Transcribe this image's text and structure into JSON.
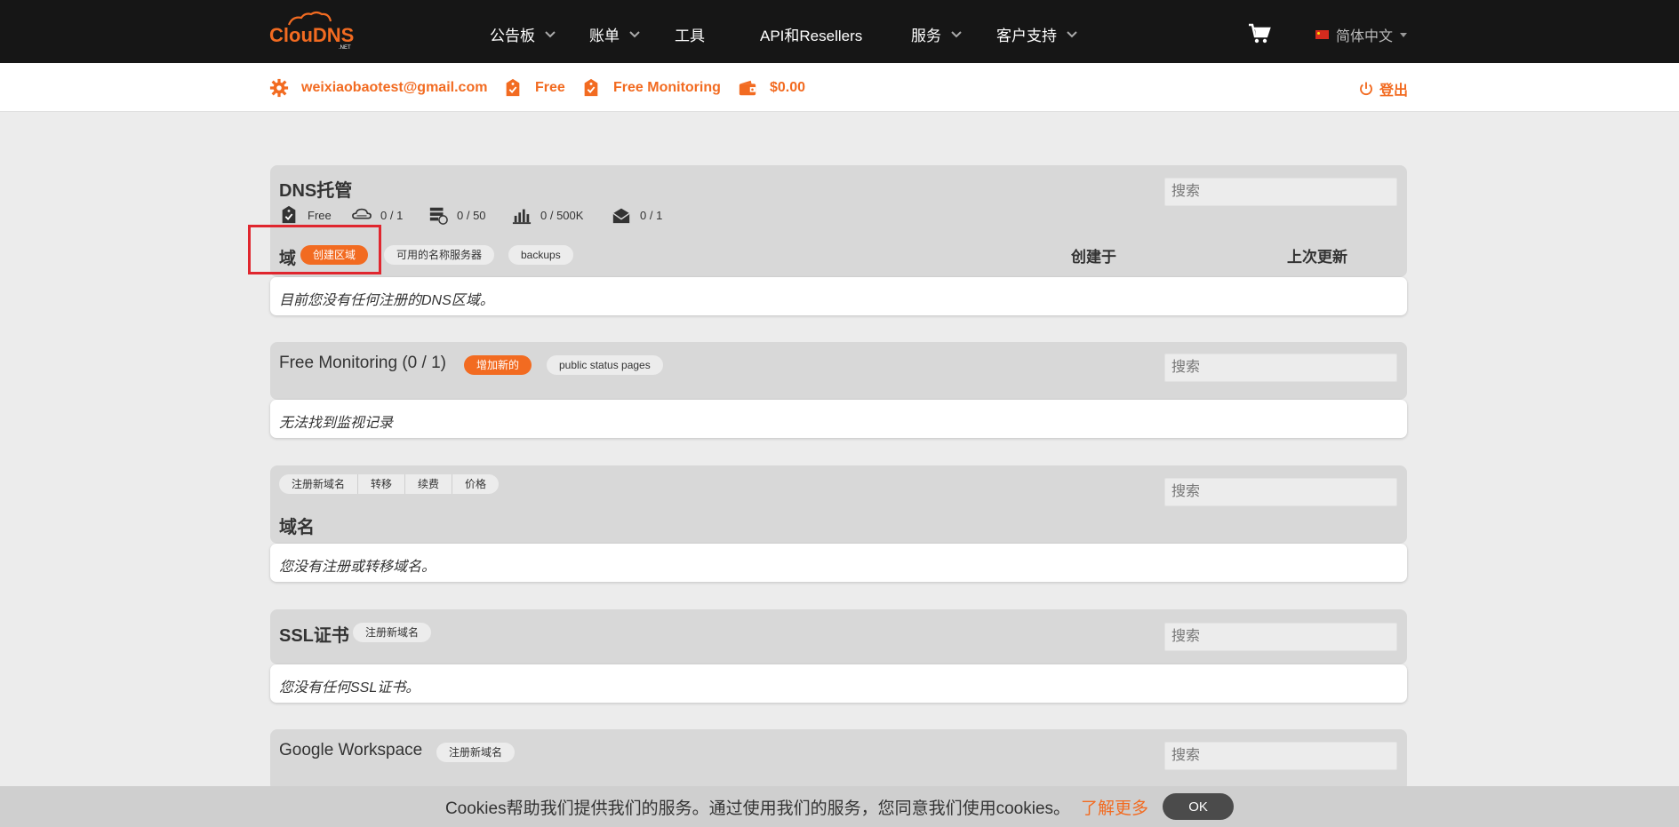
{
  "topnav": {
    "logo_text": "ClouDNS",
    "logo_sub": ".NET",
    "items": [
      "公告板",
      "账单",
      "工具",
      "API和Resellers",
      "服务",
      "客户支持"
    ],
    "language": "简体中文"
  },
  "account": {
    "email": "weixiaobaotest@gmail.com",
    "plan": "Free",
    "monitoring": "Free Monitoring",
    "balance": "$0.00",
    "logout": "登出"
  },
  "dns": {
    "title": "DNS托管",
    "search_placeholder": "搜索",
    "stats": {
      "plan": "Free",
      "zones": "0 / 1",
      "records": "0 / 50",
      "queries": "0 / 500K",
      "mail": "0 / 1"
    },
    "domain_label": "域",
    "create_zone": "创建区域",
    "nameservers": "可用的名称服务器",
    "backups": "backups",
    "col_created": "创建于",
    "col_updated": "上次更新",
    "empty": "目前您没有任何注册的DNS区域。"
  },
  "monitoring": {
    "title": "Free Monitoring (0 / 1)",
    "add_new": "增加新的",
    "status_pages": "public status pages",
    "search_placeholder": "搜索",
    "empty": "无法找到监视记录"
  },
  "domains": {
    "tabs": [
      "注册新域名",
      "转移",
      "续费",
      "价格"
    ],
    "title": "域名",
    "search_placeholder": "搜索",
    "empty": "您没有注册或转移域名。"
  },
  "ssl": {
    "title": "SSL证书",
    "register": "注册新域名",
    "search_placeholder": "搜索",
    "empty": "您没有任何SSL证书。"
  },
  "workspace": {
    "title": "Google Workspace",
    "register": "注册新域名",
    "search_placeholder": "搜索"
  },
  "cookie": {
    "text": "Cookies帮助我们提供我们的服务。通过使用我们的服务，您同意我们使用cookies。",
    "more": "了解更多",
    "ok": "OK"
  },
  "colors": {
    "accent": "#f26b21",
    "nav_bg": "#161616",
    "highlight": "#e0262e"
  }
}
